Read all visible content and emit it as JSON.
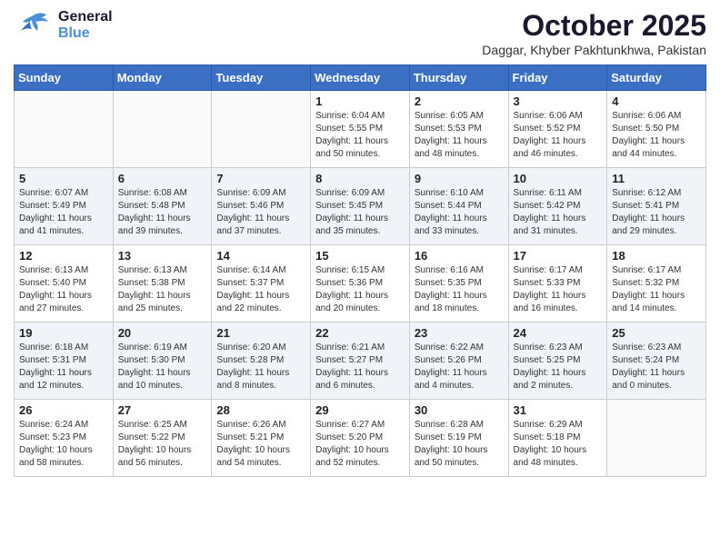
{
  "header": {
    "logo_general": "General",
    "logo_blue": "Blue",
    "month_title": "October 2025",
    "location": "Daggar, Khyber Pakhtunkhwa, Pakistan"
  },
  "weekdays": [
    "Sunday",
    "Monday",
    "Tuesday",
    "Wednesday",
    "Thursday",
    "Friday",
    "Saturday"
  ],
  "weeks": [
    [
      {
        "day": "",
        "info": ""
      },
      {
        "day": "",
        "info": ""
      },
      {
        "day": "",
        "info": ""
      },
      {
        "day": "1",
        "info": "Sunrise: 6:04 AM\nSunset: 5:55 PM\nDaylight: 11 hours\nand 50 minutes."
      },
      {
        "day": "2",
        "info": "Sunrise: 6:05 AM\nSunset: 5:53 PM\nDaylight: 11 hours\nand 48 minutes."
      },
      {
        "day": "3",
        "info": "Sunrise: 6:06 AM\nSunset: 5:52 PM\nDaylight: 11 hours\nand 46 minutes."
      },
      {
        "day": "4",
        "info": "Sunrise: 6:06 AM\nSunset: 5:50 PM\nDaylight: 11 hours\nand 44 minutes."
      }
    ],
    [
      {
        "day": "5",
        "info": "Sunrise: 6:07 AM\nSunset: 5:49 PM\nDaylight: 11 hours\nand 41 minutes."
      },
      {
        "day": "6",
        "info": "Sunrise: 6:08 AM\nSunset: 5:48 PM\nDaylight: 11 hours\nand 39 minutes."
      },
      {
        "day": "7",
        "info": "Sunrise: 6:09 AM\nSunset: 5:46 PM\nDaylight: 11 hours\nand 37 minutes."
      },
      {
        "day": "8",
        "info": "Sunrise: 6:09 AM\nSunset: 5:45 PM\nDaylight: 11 hours\nand 35 minutes."
      },
      {
        "day": "9",
        "info": "Sunrise: 6:10 AM\nSunset: 5:44 PM\nDaylight: 11 hours\nand 33 minutes."
      },
      {
        "day": "10",
        "info": "Sunrise: 6:11 AM\nSunset: 5:42 PM\nDaylight: 11 hours\nand 31 minutes."
      },
      {
        "day": "11",
        "info": "Sunrise: 6:12 AM\nSunset: 5:41 PM\nDaylight: 11 hours\nand 29 minutes."
      }
    ],
    [
      {
        "day": "12",
        "info": "Sunrise: 6:13 AM\nSunset: 5:40 PM\nDaylight: 11 hours\nand 27 minutes."
      },
      {
        "day": "13",
        "info": "Sunrise: 6:13 AM\nSunset: 5:38 PM\nDaylight: 11 hours\nand 25 minutes."
      },
      {
        "day": "14",
        "info": "Sunrise: 6:14 AM\nSunset: 5:37 PM\nDaylight: 11 hours\nand 22 minutes."
      },
      {
        "day": "15",
        "info": "Sunrise: 6:15 AM\nSunset: 5:36 PM\nDaylight: 11 hours\nand 20 minutes."
      },
      {
        "day": "16",
        "info": "Sunrise: 6:16 AM\nSunset: 5:35 PM\nDaylight: 11 hours\nand 18 minutes."
      },
      {
        "day": "17",
        "info": "Sunrise: 6:17 AM\nSunset: 5:33 PM\nDaylight: 11 hours\nand 16 minutes."
      },
      {
        "day": "18",
        "info": "Sunrise: 6:17 AM\nSunset: 5:32 PM\nDaylight: 11 hours\nand 14 minutes."
      }
    ],
    [
      {
        "day": "19",
        "info": "Sunrise: 6:18 AM\nSunset: 5:31 PM\nDaylight: 11 hours\nand 12 minutes."
      },
      {
        "day": "20",
        "info": "Sunrise: 6:19 AM\nSunset: 5:30 PM\nDaylight: 11 hours\nand 10 minutes."
      },
      {
        "day": "21",
        "info": "Sunrise: 6:20 AM\nSunset: 5:28 PM\nDaylight: 11 hours\nand 8 minutes."
      },
      {
        "day": "22",
        "info": "Sunrise: 6:21 AM\nSunset: 5:27 PM\nDaylight: 11 hours\nand 6 minutes."
      },
      {
        "day": "23",
        "info": "Sunrise: 6:22 AM\nSunset: 5:26 PM\nDaylight: 11 hours\nand 4 minutes."
      },
      {
        "day": "24",
        "info": "Sunrise: 6:23 AM\nSunset: 5:25 PM\nDaylight: 11 hours\nand 2 minutes."
      },
      {
        "day": "25",
        "info": "Sunrise: 6:23 AM\nSunset: 5:24 PM\nDaylight: 11 hours\nand 0 minutes."
      }
    ],
    [
      {
        "day": "26",
        "info": "Sunrise: 6:24 AM\nSunset: 5:23 PM\nDaylight: 10 hours\nand 58 minutes."
      },
      {
        "day": "27",
        "info": "Sunrise: 6:25 AM\nSunset: 5:22 PM\nDaylight: 10 hours\nand 56 minutes."
      },
      {
        "day": "28",
        "info": "Sunrise: 6:26 AM\nSunset: 5:21 PM\nDaylight: 10 hours\nand 54 minutes."
      },
      {
        "day": "29",
        "info": "Sunrise: 6:27 AM\nSunset: 5:20 PM\nDaylight: 10 hours\nand 52 minutes."
      },
      {
        "day": "30",
        "info": "Sunrise: 6:28 AM\nSunset: 5:19 PM\nDaylight: 10 hours\nand 50 minutes."
      },
      {
        "day": "31",
        "info": "Sunrise: 6:29 AM\nSunset: 5:18 PM\nDaylight: 10 hours\nand 48 minutes."
      },
      {
        "day": "",
        "info": ""
      }
    ]
  ]
}
